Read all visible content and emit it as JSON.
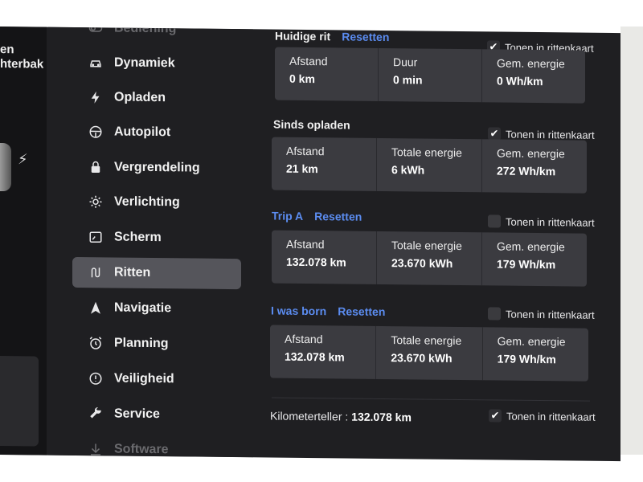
{
  "gutter": {
    "line1": "en",
    "line2": "hterbak"
  },
  "sidebar": {
    "items": [
      {
        "label": "Bediening",
        "icon": "toggle-icon"
      },
      {
        "label": "Dynamiek",
        "icon": "car-icon"
      },
      {
        "label": "Opladen",
        "icon": "bolt-icon"
      },
      {
        "label": "Autopilot",
        "icon": "steering-wheel-icon"
      },
      {
        "label": "Vergrendeling",
        "icon": "lock-icon"
      },
      {
        "label": "Verlichting",
        "icon": "sun-icon"
      },
      {
        "label": "Scherm",
        "icon": "display-icon"
      },
      {
        "label": "Ritten",
        "icon": "route-icon"
      },
      {
        "label": "Navigatie",
        "icon": "navigation-arrow-icon"
      },
      {
        "label": "Planning",
        "icon": "alarm-clock-icon"
      },
      {
        "label": "Veiligheid",
        "icon": "alert-circle-icon"
      },
      {
        "label": "Service",
        "icon": "wrench-icon"
      },
      {
        "label": "Software",
        "icon": "download-icon"
      }
    ],
    "active": "Ritten"
  },
  "current_trip": {
    "title": "Huidige rit",
    "reset": "Resetten",
    "show_label": "Tonen in rittenkaart",
    "show_checked": true,
    "cells": [
      {
        "key": "Afstand",
        "value": "0 km"
      },
      {
        "key": "Duur",
        "value": "0 min"
      },
      {
        "key": "Gem. energie",
        "value": "0 Wh/km"
      }
    ]
  },
  "since_charge": {
    "title": "Sinds opladen",
    "show_label": "Tonen in rittenkaart",
    "show_checked": true,
    "cells": [
      {
        "key": "Afstand",
        "value": "21 km"
      },
      {
        "key": "Totale energie",
        "value": "6 kWh"
      },
      {
        "key": "Gem. energie",
        "value": "272 Wh/km"
      }
    ]
  },
  "trip_a": {
    "title": "Trip A",
    "reset": "Resetten",
    "show_label": "Tonen in rittenkaart",
    "show_checked": false,
    "cells": [
      {
        "key": "Afstand",
        "value": "132.078 km"
      },
      {
        "key": "Totale energie",
        "value": "23.670 kWh"
      },
      {
        "key": "Gem. energie",
        "value": "179 Wh/km"
      }
    ]
  },
  "trip_b": {
    "title": "I was born",
    "reset": "Resetten",
    "show_label": "Tonen in rittenkaart",
    "show_checked": false,
    "cells": [
      {
        "key": "Afstand",
        "value": "132.078 km"
      },
      {
        "key": "Totale energie",
        "value": "23.670 kWh"
      },
      {
        "key": "Gem. energie",
        "value": "179 Wh/km"
      }
    ]
  },
  "odometer": {
    "label": "Kilometerteller",
    "separator": ":",
    "value": "132.078 km",
    "show_label": "Tonen in rittenkaart",
    "show_checked": true
  },
  "colors": {
    "accent": "#5b8cf0",
    "background": "#1f1f22",
    "card": "#3b3b40",
    "active_item": "#55555b"
  }
}
